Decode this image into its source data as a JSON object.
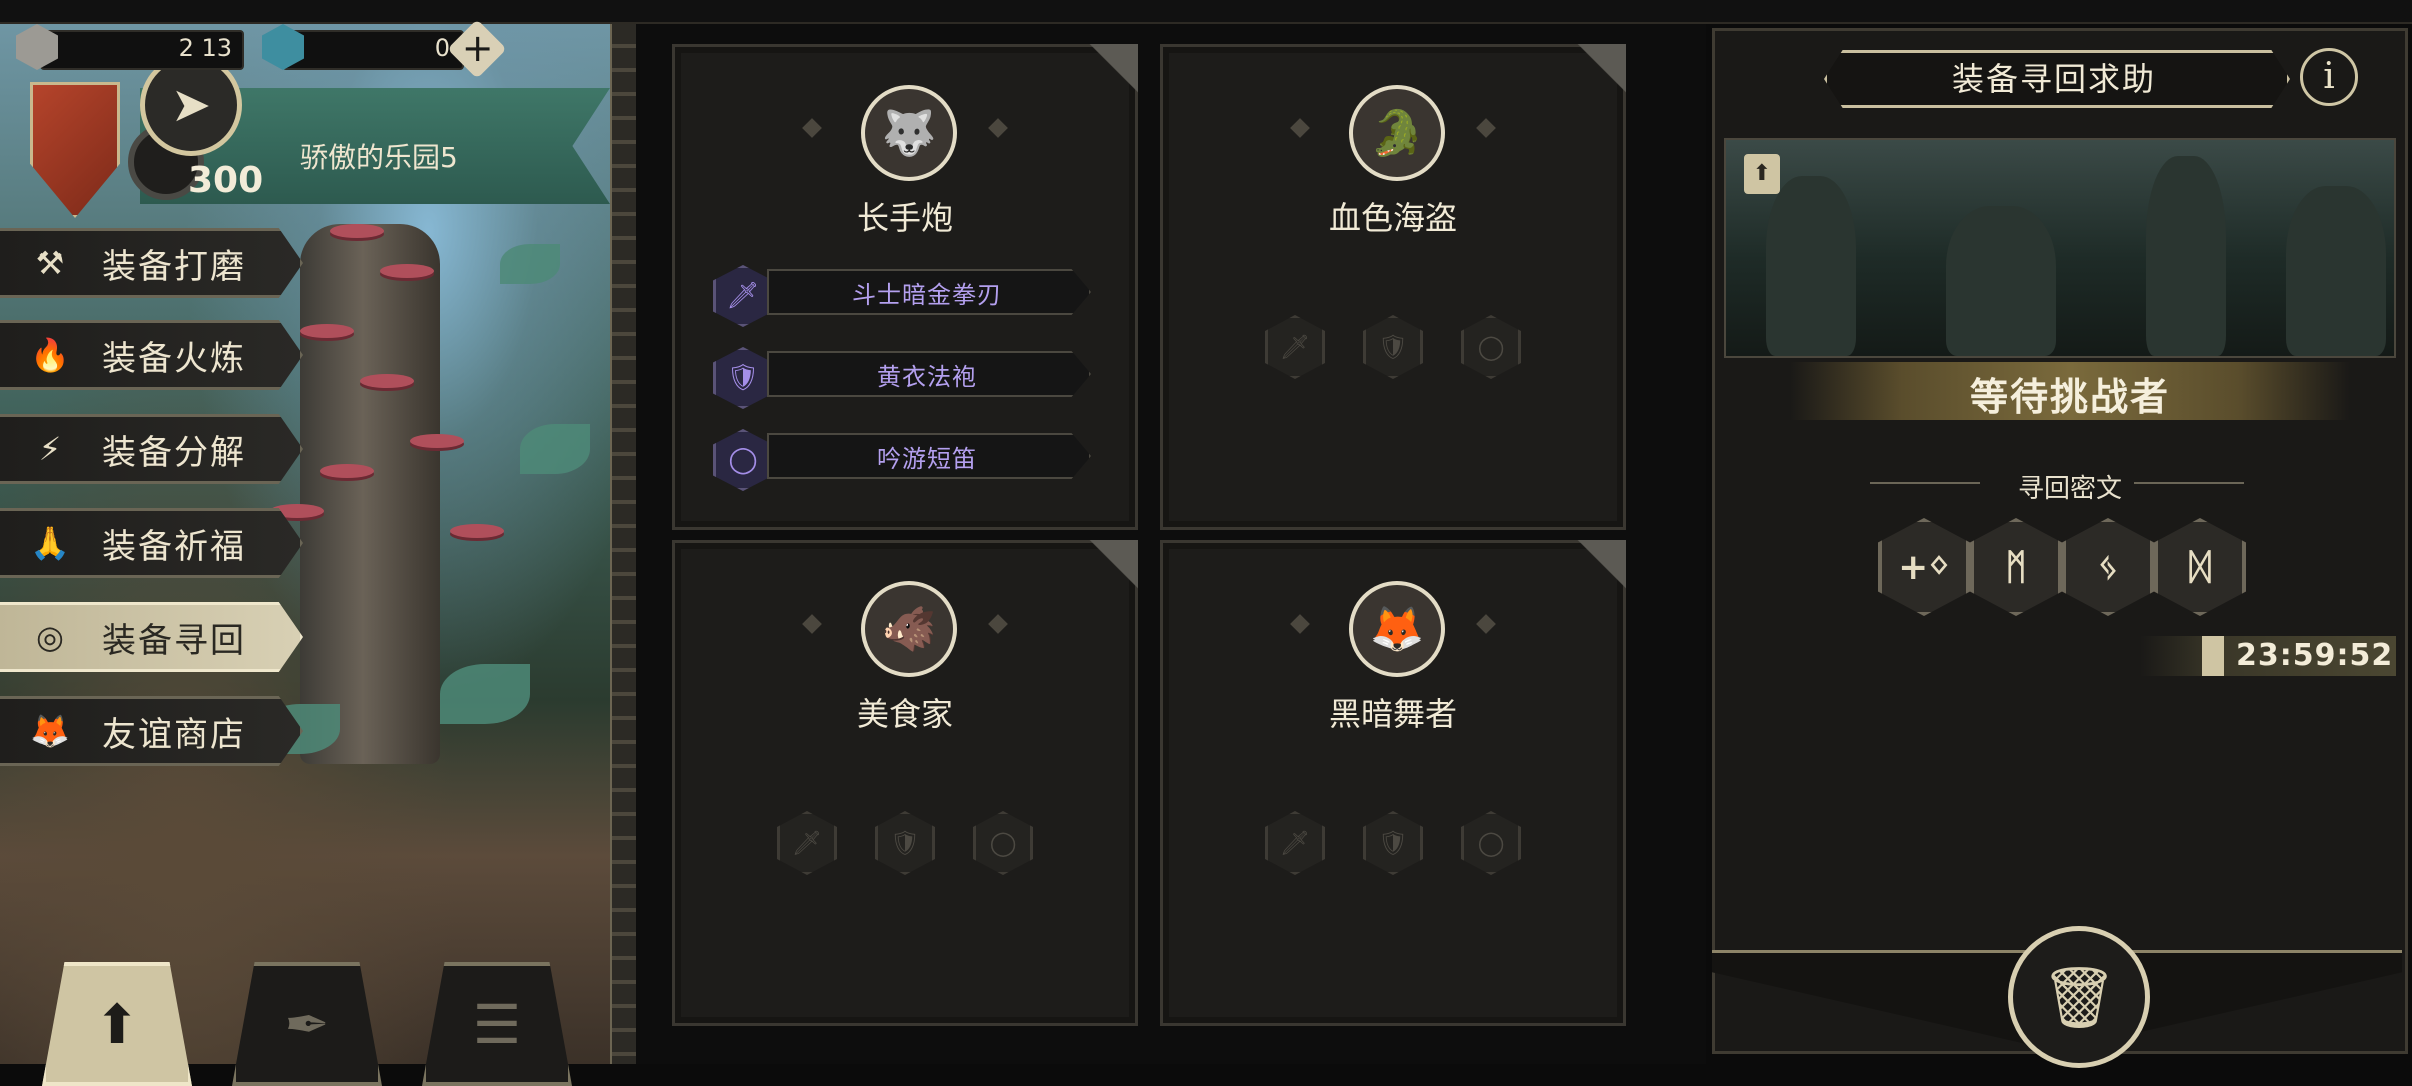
{
  "currency": {
    "gems_value": "2 13",
    "crystal_value": "0",
    "plus_label": "+"
  },
  "header": {
    "power_value": "300",
    "location": "骄傲的乐园5",
    "back_icon": "back-arrow-icon"
  },
  "menu": [
    {
      "label": "装备打磨",
      "icon": "hammer-icon",
      "glyph": "⚒",
      "active": false
    },
    {
      "label": "装备火炼",
      "icon": "flame-icon",
      "glyph": "🔥",
      "active": false
    },
    {
      "label": "装备分解",
      "icon": "break-icon",
      "glyph": "⚡",
      "active": false
    },
    {
      "label": "装备祈福",
      "icon": "pray-hands-icon",
      "glyph": "🙏",
      "active": false
    },
    {
      "label": "装备寻回",
      "icon": "target-icon",
      "glyph": "◎",
      "active": true
    },
    {
      "label": "友谊商店",
      "icon": "fox-icon",
      "glyph": "🦊",
      "active": false
    }
  ],
  "bottom_buttons": [
    {
      "icon": "upload-arrow-icon",
      "glyph": "⬆",
      "active": true
    },
    {
      "icon": "feather-scroll-icon",
      "glyph": "✒",
      "active": false
    },
    {
      "icon": "list-icon",
      "glyph": "☰",
      "active": false
    }
  ],
  "cards": [
    {
      "name": "长手炮",
      "portrait": "wolf-portrait-icon",
      "glyph": "🐺",
      "equipment": [
        {
          "label": "斗士暗金拳刃",
          "icon": "sword-icon",
          "glyph": "🗡"
        },
        {
          "label": "黄衣法袍",
          "icon": "armor-icon",
          "glyph": "🛡"
        },
        {
          "label": "吟游短笛",
          "icon": "ring-icon",
          "glyph": "◯"
        }
      ]
    },
    {
      "name": "血色海盗",
      "portrait": "crocodile-portrait-icon",
      "glyph": "🐊",
      "equipment": []
    },
    {
      "name": "美食家",
      "portrait": "beast-portrait-icon",
      "glyph": "🐗",
      "equipment": []
    },
    {
      "name": "黑暗舞者",
      "portrait": "fox-girl-portrait-icon",
      "glyph": "🦊",
      "equipment": []
    }
  ],
  "empty_slots": [
    {
      "icon": "sword-slot-icon",
      "glyph": "🗡"
    },
    {
      "icon": "armor-slot-icon",
      "glyph": "🛡"
    },
    {
      "icon": "ring-slot-icon",
      "glyph": "◯"
    }
  ],
  "right_panel": {
    "title": "装备寻回求助",
    "info_label": "i",
    "preview_tag": "⬆",
    "status": "等待挑战者",
    "cipher_label": "寻回密文",
    "runes": [
      "+ᛜ",
      "ᛗ",
      "ᛃ",
      "ᛞ"
    ],
    "timer": "23:59:52",
    "trash_icon": "trash-icon"
  }
}
